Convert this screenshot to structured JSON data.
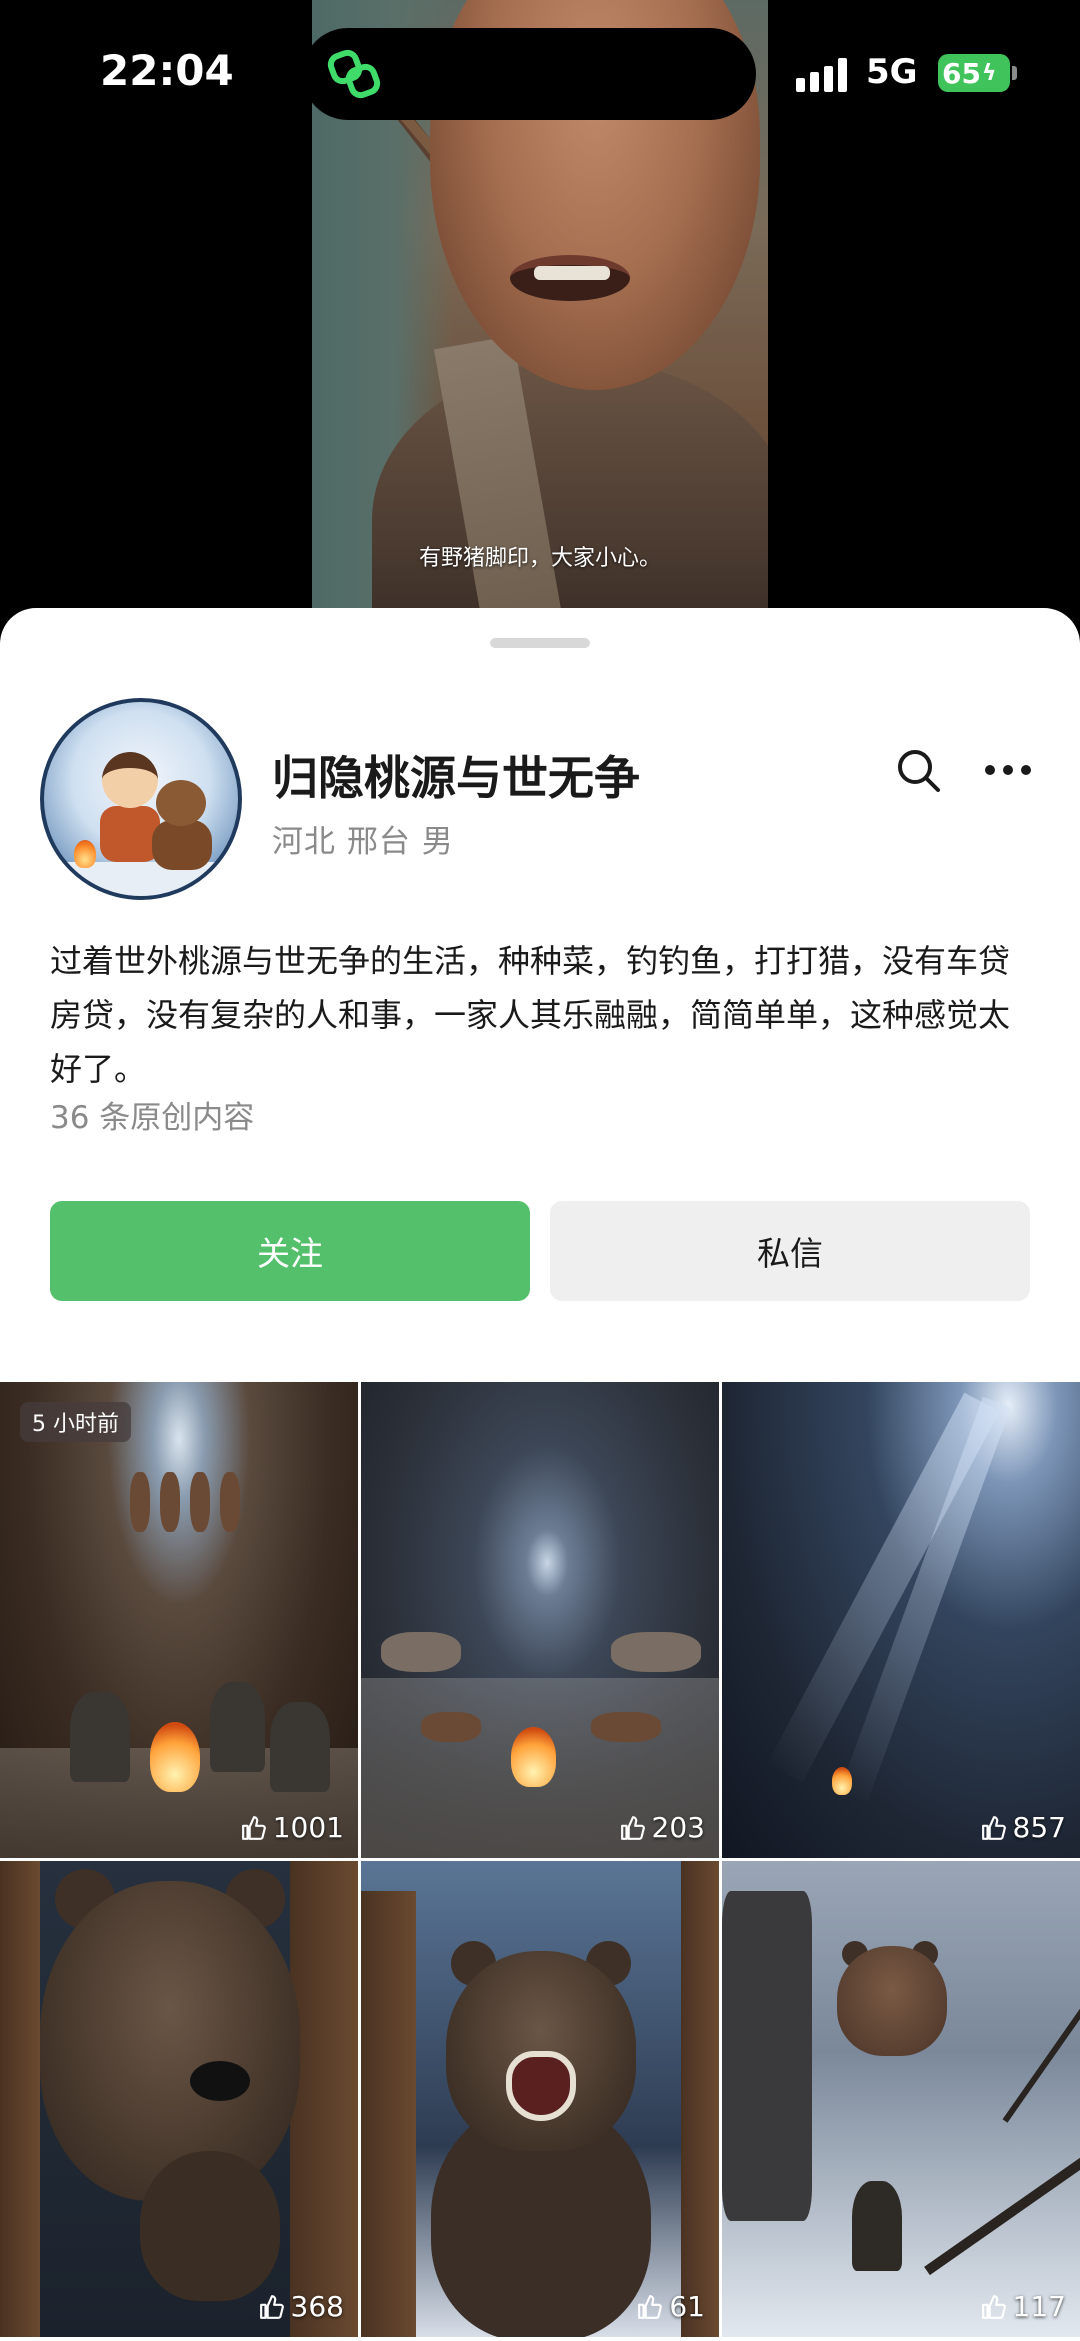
{
  "status_bar": {
    "time": "22:04",
    "network": "5G",
    "battery": "65",
    "island_icon": "link-app-icon"
  },
  "video": {
    "subtitle": "有野猪脚印，大家小心。"
  },
  "profile": {
    "name": "归隐桃源与世无争",
    "location": "河北 邢台 男",
    "bio": "过着世外桃源与世无争的生活，种种菜，钓钓鱼，打打猎，没有车贷房贷，没有复杂的人和事，一家人其乐融融，简简单单，这种感觉太好了。",
    "original_count": "36 条原创内容",
    "follow_label": "关注",
    "message_label": "私信"
  },
  "icons": {
    "search": "search-icon",
    "more": "more-icon",
    "like": "thumbs-up-icon"
  },
  "grid": [
    {
      "likes": "1001",
      "badge": "5 小时前"
    },
    {
      "likes": "203"
    },
    {
      "likes": "857"
    },
    {
      "likes": "368"
    },
    {
      "likes": "61"
    },
    {
      "likes": "117"
    }
  ],
  "colors": {
    "follow_button": "#54c06b",
    "message_button": "#efefef",
    "battery": "#3fc35a"
  }
}
